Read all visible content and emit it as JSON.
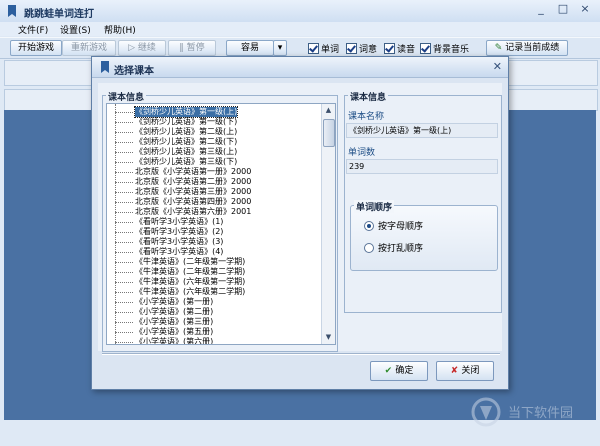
{
  "window": {
    "title": "跳跳蛙单词连打",
    "controls": [
      "_",
      "□",
      "×"
    ]
  },
  "menu": [
    "文件(F)",
    "设置(S)",
    "帮助(H)"
  ],
  "toolbar": {
    "start": "开始游戏",
    "restart": "重新游戏",
    "continue": "继续",
    "pause": "暂停",
    "difficulty": "容易",
    "checks": [
      {
        "label": "单词",
        "checked": true
      },
      {
        "label": "词意",
        "checked": true
      },
      {
        "label": "读音",
        "checked": true
      },
      {
        "label": "背景音乐",
        "checked": true
      }
    ],
    "record": "记录当前成绩"
  },
  "dialog": {
    "title": "选择课本",
    "left_group": "课本信息",
    "books": [
      "《剑桥少儿英语》第一级(上)",
      "《剑桥少儿英语》第一级(下)",
      "《剑桥少儿英语》第二级(上)",
      "《剑桥少儿英语》第二级(下)",
      "《剑桥少儿英语》第三级(上)",
      "《剑桥少儿英语》第三级(下)",
      "北京版《小学英语第一册》2000",
      "北京版《小学英语第二册》2000",
      "北京版《小学英语第三册》2000",
      "北京版《小学英语第四册》2000",
      "北京版《小学英语第六册》2001",
      "《看听学3小学英语》(1)",
      "《看听学3小学英语》(2)",
      "《看听学3小学英语》(3)",
      "《看听学3小学英语》(4)",
      "《牛津英语》(二年级第一学期)",
      "《牛津英语》(二年级第二学期)",
      "《牛津英语》(六年级第一学期)",
      "《牛津英语》(六年级第二学期)",
      "《小学英语》(第一册)",
      "《小学英语》(第二册)",
      "《小学英语》(第三册)",
      "《小学英语》(第五册)",
      "《小学英语》(第六册)"
    ],
    "selected_index": 0,
    "right_group": "课本信息",
    "name_label": "课本名称",
    "name_value": "《剑桥少儿英语》第一级(上)",
    "count_label": "单词数",
    "count_value": "239",
    "order_group": "单词顺序",
    "order_options": [
      "按字母顺序",
      "按打乱顺序"
    ],
    "order_selected": 0,
    "ok": "确定",
    "close": "关闭"
  },
  "watermark": "当下软件园"
}
